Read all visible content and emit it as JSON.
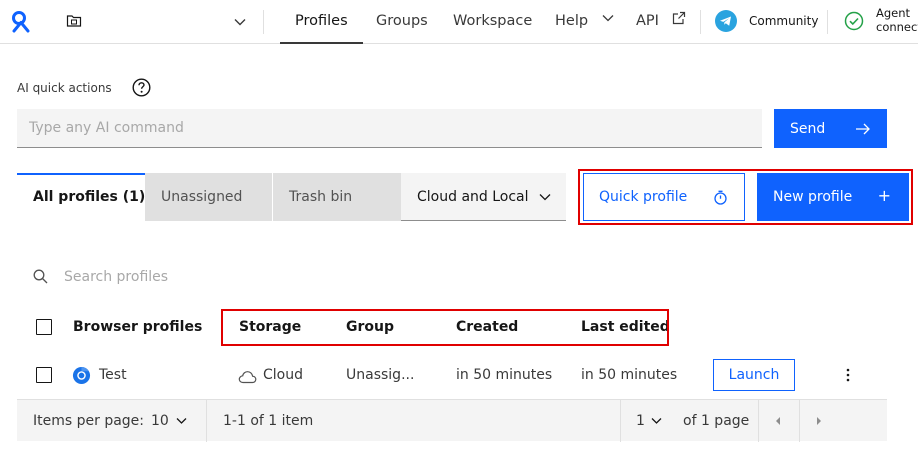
{
  "topbar": {
    "nav": [
      {
        "label": "Profiles"
      },
      {
        "label": "Groups"
      },
      {
        "label": "Workspace"
      },
      {
        "label": "Help"
      },
      {
        "label": "API"
      }
    ],
    "community_label": "Community",
    "agent_line1": "Agent",
    "agent_line2": "connected"
  },
  "ai": {
    "label": "AI quick actions",
    "placeholder": "Type any AI command",
    "send_label": "Send"
  },
  "tabs": [
    {
      "label": "All profiles (1)"
    },
    {
      "label": "Unassigned"
    },
    {
      "label": "Trash bin"
    }
  ],
  "storage_filter": {
    "selected": "Cloud and Local"
  },
  "actions": {
    "quick_profile": "Quick profile",
    "new_profile": "New profile",
    "plus_glyph": "+"
  },
  "search": {
    "placeholder": "Search profiles"
  },
  "table": {
    "headers": {
      "name": "Browser profiles",
      "storage": "Storage",
      "group": "Group",
      "created": "Created",
      "edited": "Last edited"
    },
    "rows": [
      {
        "name": "Test",
        "storage": "Cloud",
        "group": "Unassig...",
        "created": "in 50 minutes",
        "edited": "in 50 minutes",
        "action": "Launch"
      }
    ]
  },
  "pagination": {
    "items_per_page_label": "Items per page:",
    "items_per_page": "10",
    "range": "1-1 of 1 item",
    "page": "1",
    "of_pages": "of 1 page"
  },
  "colors": {
    "primary": "#0f62fe",
    "highlight": "#e00000",
    "telegram": "#2aa3df",
    "success": "#24a148"
  }
}
